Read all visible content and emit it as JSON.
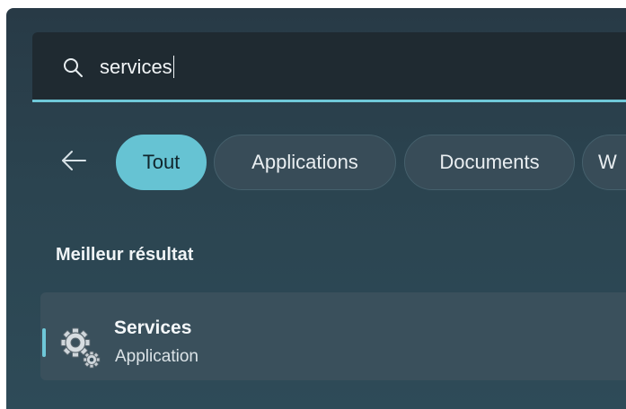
{
  "search": {
    "query": "services"
  },
  "filters": [
    {
      "label": "Tout",
      "active": true
    },
    {
      "label": "Applications",
      "active": false
    },
    {
      "label": "Documents",
      "active": false
    },
    {
      "label": "W",
      "active": false
    }
  ],
  "section_title": "Meilleur résultat",
  "best_result": {
    "name": "Services",
    "type": "Application",
    "icon": "services-gear-icon"
  },
  "colors": {
    "accent": "#66c3d3",
    "panel": "#2b4450",
    "search_bg": "#1f2a31"
  },
  "icons": {
    "search": "search-icon",
    "back": "back-arrow-icon"
  }
}
